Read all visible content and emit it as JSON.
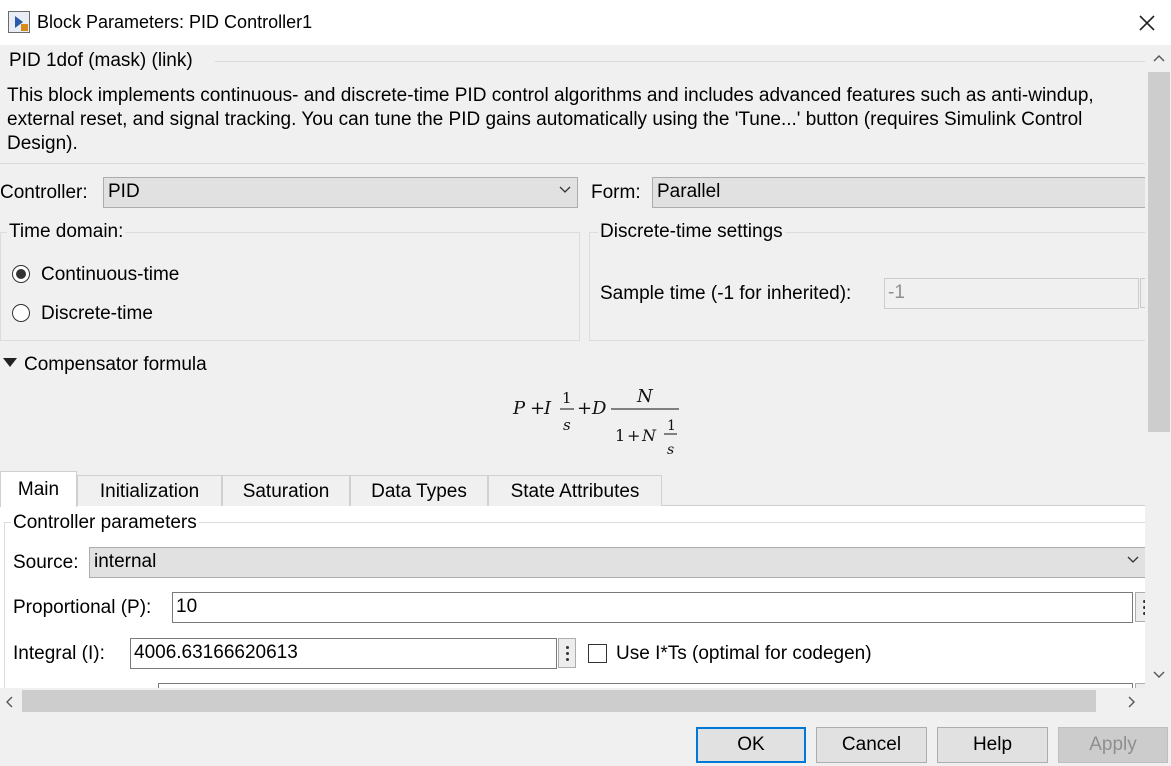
{
  "window": {
    "title": "Block Parameters: PID Controller1",
    "app_icon": "simulink-block-icon",
    "close_icon": "close-icon"
  },
  "mask": {
    "title": "PID 1dof (mask) (link)",
    "description_lines": [
      "This block implements continuous- and discrete-time PID control algorithms and includes advanced features such as anti-windup,",
      "external reset, and signal tracking. You can tune the PID gains automatically using the 'Tune...' button (requires Simulink Control",
      "Design)."
    ]
  },
  "controller": {
    "label": "Controller:",
    "value": "PID"
  },
  "form": {
    "label": "Form:",
    "value": "Parallel"
  },
  "time_domain": {
    "title": "Time domain:",
    "options": [
      {
        "label": "Continuous-time",
        "checked": true
      },
      {
        "label": "Discrete-time",
        "checked": false
      }
    ]
  },
  "discrete_settings": {
    "title": "Discrete-time settings",
    "sample_time_label": "Sample time (-1 for inherited):",
    "sample_time_value": "-1"
  },
  "compensator": {
    "header": "Compensator formula",
    "expanded": true,
    "formula": {
      "P": "P",
      "plus": "+",
      "I": "I",
      "one": "1",
      "s": "s",
      "D": "D",
      "N": "N"
    }
  },
  "tabs": [
    {
      "label": "Main",
      "active": true
    },
    {
      "label": "Initialization",
      "active": false
    },
    {
      "label": "Saturation",
      "active": false
    },
    {
      "label": "Data Types",
      "active": false
    },
    {
      "label": "State Attributes",
      "active": false
    }
  ],
  "main_tab": {
    "group_title": "Controller parameters",
    "source": {
      "label": "Source:",
      "value": "internal"
    },
    "proportional": {
      "label": "Proportional (P):",
      "value": "10"
    },
    "integral": {
      "label": "Integral (I):",
      "value": "4006.63166620613"
    },
    "use_its": {
      "label": "Use I*Ts (optimal for codegen)",
      "checked": false
    }
  },
  "buttons": {
    "ok": "OK",
    "cancel": "Cancel",
    "help": "Help",
    "apply": "Apply"
  }
}
